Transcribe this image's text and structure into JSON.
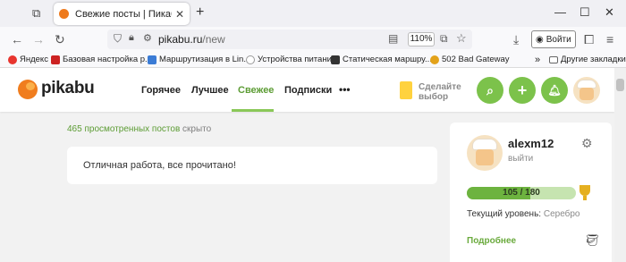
{
  "browser": {
    "tab_title": "Свежие посты | Пикабу",
    "url_host": "pikabu.ru",
    "url_path": "/new",
    "zoom": "110%",
    "login_label": "Войти"
  },
  "bookmarks": [
    {
      "label": "Яндекс",
      "color": "#e8352e"
    },
    {
      "label": "Базовая настройка р...",
      "color": "#cc2222"
    },
    {
      "label": "Маршрутизация в Lin...",
      "color": "#3a7bd5"
    },
    {
      "label": "Устройства питания",
      "color": "#e0e0e0"
    },
    {
      "label": "Статическая маршру...",
      "color": "#333333"
    },
    {
      "label": "502 Bad Gateway",
      "color": "#e3a21a"
    }
  ],
  "other_bookmarks": "Другие закладки",
  "site": {
    "logo": "pikabu",
    "menu": [
      "Горячее",
      "Лучшее",
      "Свежее",
      "Подписки"
    ],
    "active_menu": "Свежее",
    "more_menu": "•••",
    "promo": [
      "Сделайте",
      "выбор"
    ],
    "accent_color": "#7cc24b"
  },
  "feed": {
    "viewed_link": "465 просмотренных постов",
    "viewed_suffix": " скрыто",
    "done_message": "Отличная работа, все прочитано!"
  },
  "profile": {
    "username": "alexm12",
    "subtitle": "выйти",
    "progress_current": 105,
    "progress_max": 180,
    "progress_text": "105 / 180",
    "level_label": "Текущий уровень: ",
    "level_value": "Серебро",
    "more_label": "Подробнее"
  }
}
